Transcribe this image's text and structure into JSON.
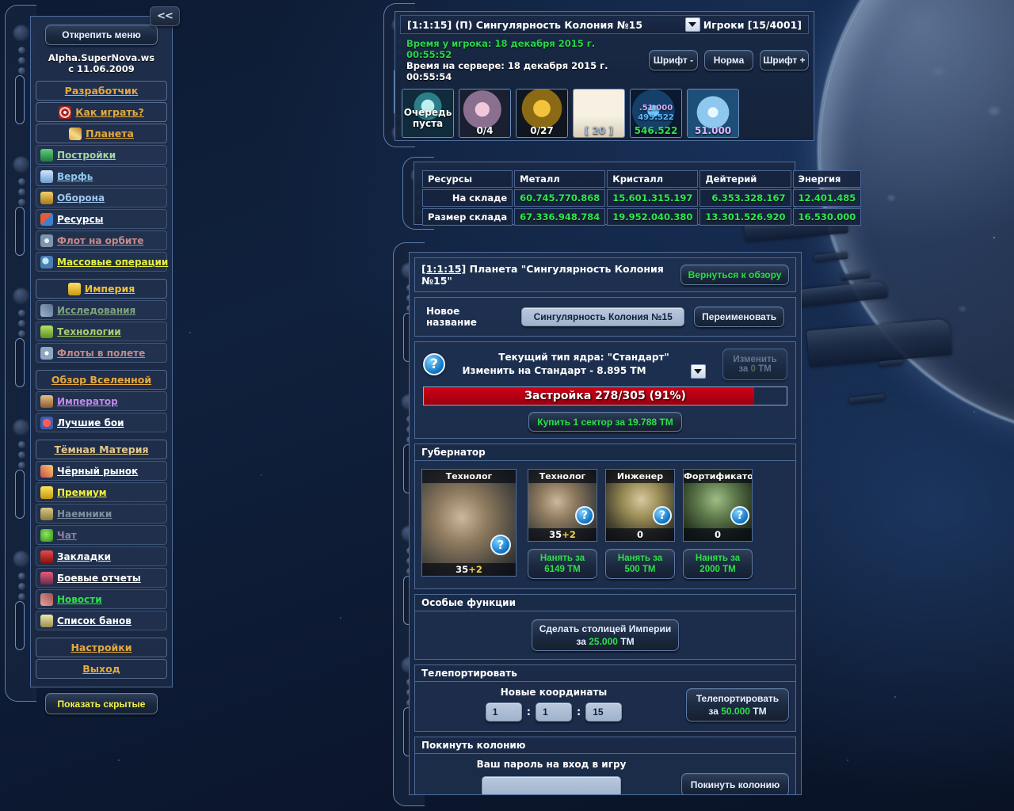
{
  "sidebar": {
    "collapse_label": "<<",
    "unpin_label": "Открепить меню",
    "brand_line1": "Alpha.SuperNova.ws",
    "brand_line2": "с 11.06.2009",
    "show_hidden_label": "Показать скрытые",
    "items": [
      {
        "label": "Разработчик",
        "icon": "",
        "color": "#e5a93c",
        "type": "section"
      },
      {
        "label": "Как играть?",
        "icon": "target-icon",
        "color": "#e5a93c",
        "type": "section"
      },
      {
        "label": "Планета",
        "icon": "planet-icon",
        "color": "#e5a93c",
        "type": "section"
      },
      {
        "label": "Постройки",
        "icon": "buildings-icon",
        "color": "#9fd9a0",
        "type": "item"
      },
      {
        "label": "Верфь",
        "icon": "shipyard-icon",
        "color": "#8fc8ef",
        "type": "item"
      },
      {
        "label": "Оборона",
        "icon": "shield-icon",
        "color": "#9fc6ef",
        "type": "item"
      },
      {
        "label": "Ресурсы",
        "icon": "tools-icon",
        "color": "#ffffff",
        "type": "item"
      },
      {
        "label": "Флот на орбите",
        "icon": "fleet-icon",
        "color": "#c98a8a",
        "type": "item"
      },
      {
        "label": "Массовые операции",
        "icon": "mass-ops-icon",
        "color": "#e8ef3f",
        "type": "item"
      },
      {
        "label": "Империя",
        "icon": "crown-icon",
        "color": "#f0c02e",
        "type": "section"
      },
      {
        "label": "Исследования",
        "icon": "research-icon",
        "color": "#7fa37f",
        "type": "item"
      },
      {
        "label": "Технологии",
        "icon": "tech-icon",
        "color": "#a8cf6e",
        "type": "item"
      },
      {
        "label": "Флоты в полете",
        "icon": "flying-fleets-icon",
        "color": "#c08a8a",
        "type": "item"
      },
      {
        "label": "Обзор Вселенной",
        "icon": "",
        "color": "#e5a93c",
        "type": "section"
      },
      {
        "label": "Император",
        "icon": "emperor-icon",
        "color": "#c08ae8",
        "type": "item"
      },
      {
        "label": "Лучшие бои",
        "icon": "battles-icon",
        "color": "#ffffff",
        "type": "item"
      },
      {
        "label": "Тёмная Материя",
        "icon": "",
        "color": "#e5c98a",
        "type": "section"
      },
      {
        "label": "Чёрный рынок",
        "icon": "market-icon",
        "color": "#ffffff",
        "type": "item"
      },
      {
        "label": "Премиум",
        "icon": "premium-icon",
        "color": "#f2ef3f",
        "type": "item"
      },
      {
        "label": "Наемники",
        "icon": "mercenary-icon",
        "color": "#7f8e9e",
        "type": "item"
      },
      {
        "label": "Чат",
        "icon": "chat-icon",
        "color": "#8f7fa8",
        "type": "item"
      },
      {
        "label": "Закладки",
        "icon": "bookmarks-icon",
        "color": "#ffffff",
        "type": "item"
      },
      {
        "label": "Боевые отчеты",
        "icon": "combat-reports-icon",
        "color": "#ffffff",
        "type": "item"
      },
      {
        "label": "Новости",
        "icon": "news-icon",
        "color": "#2ce048",
        "type": "item"
      },
      {
        "label": "Список банов",
        "icon": "bans-icon",
        "color": "#ffffff",
        "type": "item"
      },
      {
        "label": "Настройки",
        "icon": "",
        "color": "#e5a93c",
        "type": "section"
      },
      {
        "label": "Выход",
        "icon": "",
        "color": "#e5a93c",
        "type": "section"
      }
    ]
  },
  "topbar": {
    "coord_text": "[1:1:15] (П) Сингулярность Колония №15",
    "players_count": "Игроки [15/4001]",
    "time_player": "Время у игрока: 18 декабря 2015 г. 00:55:52",
    "time_server": "Время на сервере: 18 декабря 2015 г. 00:55:54",
    "font_minus": "Шрифт -",
    "font_normal": "Норма",
    "font_plus": "Шрифт +",
    "tiles": [
      {
        "name": "build-queue-tile",
        "caption": "Очередь пуста",
        "icon": "rocket-icon"
      },
      {
        "name": "research-tile",
        "caption": "0/4",
        "icon": "nebula-icon"
      },
      {
        "name": "shipyard-tile",
        "caption": "0/27",
        "icon": "mech-icon"
      },
      {
        "name": "messages-tile",
        "caption": "[ 20 ]",
        "icon": "envelope-icon"
      },
      {
        "name": "dark-matter-tile",
        "caption": "546.522",
        "icon": "darkmatter-icon",
        "line1": ".51.000",
        "line2": "495.522"
      },
      {
        "name": "crystal-tile",
        "caption": "51.000",
        "icon": "snowflake-icon"
      }
    ]
  },
  "resources": {
    "headers": [
      "Ресурсы",
      "Металл",
      "Кристалл",
      "Дейтерий",
      "Энергия"
    ],
    "rows": [
      {
        "label": "На складе",
        "values": [
          "60.745.770.868",
          "15.601.315.197",
          "6.353.328.167",
          "12.401.485"
        ]
      },
      {
        "label": "Размер склада",
        "values": [
          "67.336.948.784",
          "19.952.040.380",
          "13.301.526.920",
          "16.530.000"
        ]
      }
    ]
  },
  "main": {
    "planet_coord": "[1:1:15]",
    "planet_title": " Планета \"Сингулярность Колония №15\"",
    "back_label": "Вернуться к обзору",
    "rename_label": "Новое название",
    "rename_value": "Сингулярность Колония №15",
    "rename_button": "Переименовать",
    "core_line1": "Текущий тип ядра: \"Стандарт\"",
    "core_line2": "Изменить на Стандарт - 8.895 ТМ",
    "core_change_line1": "Изменить",
    "core_change_za": "за ",
    "core_change_cost": "0",
    "core_change_unit": " ТМ",
    "build_text": "Застройка 278/305 (91%)",
    "build_percent": 91,
    "buy_sector_label": "Купить 1 сектор за 19.788 ТМ",
    "help_glyph": "?",
    "governor": {
      "section_title": "Губернатор",
      "current": {
        "title": "Технолог",
        "level": "35",
        "bonus": "+2",
        "face": "face-b"
      },
      "cards": [
        {
          "title": "Технолог",
          "level": "35",
          "bonus": "+2",
          "face": "face-b",
          "hire": "Нанять за\n6149 ТМ",
          "hire_line1": "Нанять за",
          "hire_line2": "6149 ТМ"
        },
        {
          "title": "Инженер",
          "level": "0",
          "bonus": "",
          "face": "face-c",
          "hire_line1": "Нанять за",
          "hire_line2": "500 ТМ"
        },
        {
          "title": "Фортификатор",
          "level": "0",
          "bonus": "",
          "face": "face-d",
          "hire_line1": "Нанять за",
          "hire_line2": "2000 ТМ"
        }
      ]
    },
    "special": {
      "section_title": "Особые функции",
      "capital_line1": "Сделать столицей Империи",
      "capital_za": "за ",
      "capital_cost": "25.000",
      "capital_unit": " ТМ"
    },
    "teleport": {
      "section_title": "Телепортировать",
      "coords_label": "Новые координаты",
      "galaxy": "1",
      "system": "1",
      "planet": "15",
      "separator": ":",
      "btn_line1": "Телепортировать",
      "btn_za": "за ",
      "btn_cost": "50.000",
      "btn_unit": " ТМ"
    },
    "leave": {
      "section_title": "Покинуть колонию",
      "password_label": "Ваш пароль на вход в игру",
      "password_value": "",
      "button_label": "Покинуть колонию"
    }
  },
  "colors": {
    "accent_gold": "#e5a93c",
    "green": "#2ce048",
    "panel_border": "#4e6d9c",
    "build_bar": "#cf0016"
  }
}
